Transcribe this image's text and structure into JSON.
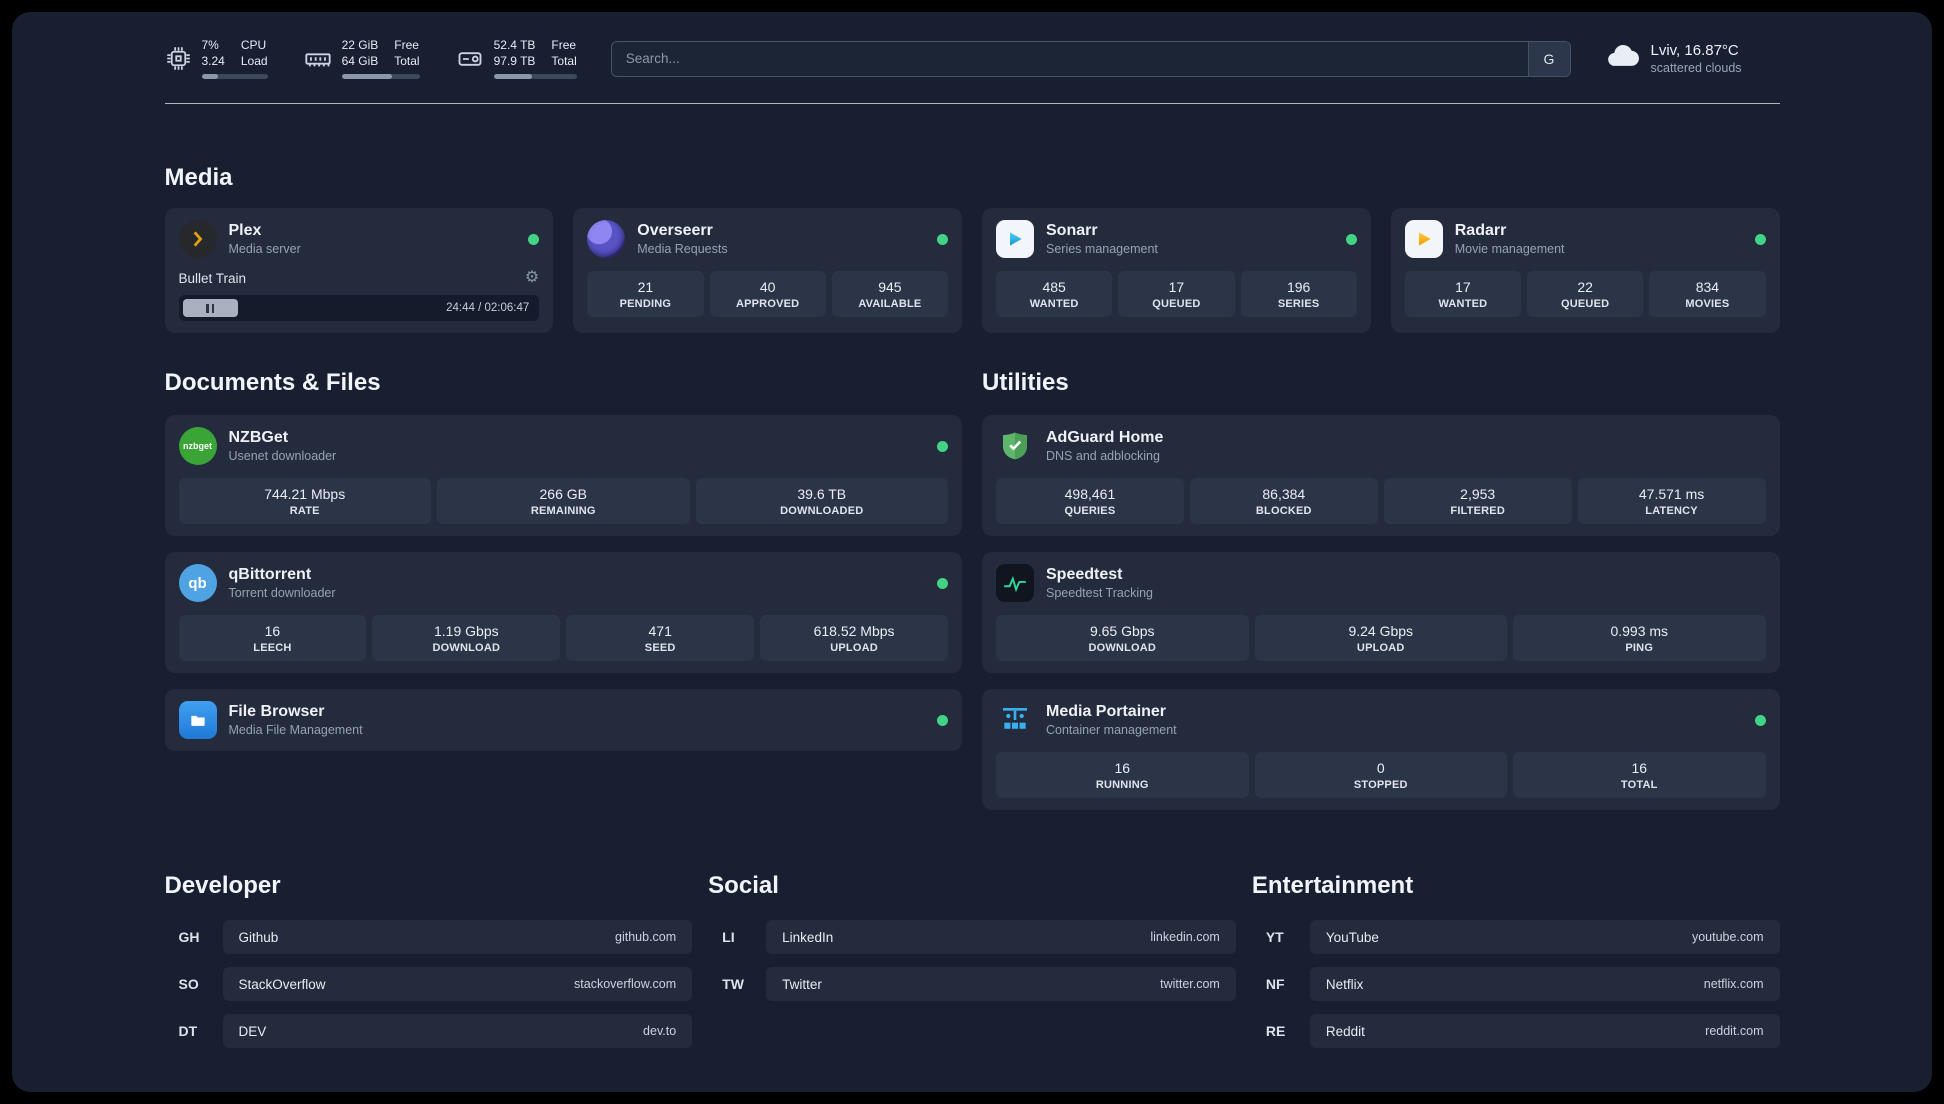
{
  "colors": {
    "page_bg": "#171f31",
    "card_bg": "#232b3d",
    "tile_bg": "#2c3547",
    "status_green": "#42d385",
    "plex_amber": "#e5a00d",
    "sonarr_blue": "#2cc5f4",
    "radarr_amber": "#ffb300",
    "nzbget_green": "#3ba437",
    "qbittorrent_blue": "#4fa3e3",
    "adguard_green": "#60b56c",
    "speedtest_green": "#2fd89a",
    "portainer_blue": "#3aaff0"
  },
  "topbar": {
    "cpu": {
      "value": "7%",
      "sub": "3.24",
      "label1": "CPU",
      "label2": "Load",
      "bar": 25
    },
    "ram": {
      "value": "22 GiB",
      "sub": "64 GiB",
      "label1": "Free",
      "label2": "Total",
      "bar": 65
    },
    "disk": {
      "value": "52.4 TB",
      "sub": "97.9 TB",
      "label1": "Free",
      "label2": "Total",
      "bar": 46
    },
    "search": {
      "placeholder": "Search...",
      "engine_label": "G"
    },
    "weather": {
      "location": "Lviv, 16.87°C",
      "condition": "scattered clouds"
    }
  },
  "sections": {
    "media": "Media",
    "documents": "Documents & Files",
    "utilities": "Utilities",
    "developer": "Developer",
    "social": "Social",
    "entertainment": "Entertainment"
  },
  "media": {
    "plex": {
      "name": "Plex",
      "desc": "Media server",
      "now_playing": "Bullet Train",
      "time": "24:44 / 02:06:47",
      "progress": 16
    },
    "overseerr": {
      "name": "Overseerr",
      "desc": "Media Requests",
      "stats": [
        {
          "value": "21",
          "label": "PENDING"
        },
        {
          "value": "40",
          "label": "APPROVED"
        },
        {
          "value": "945",
          "label": "AVAILABLE"
        }
      ]
    },
    "sonarr": {
      "name": "Sonarr",
      "desc": "Series management",
      "stats": [
        {
          "value": "485",
          "label": "WANTED"
        },
        {
          "value": "17",
          "label": "QUEUED"
        },
        {
          "value": "196",
          "label": "SERIES"
        }
      ]
    },
    "radarr": {
      "name": "Radarr",
      "desc": "Movie management",
      "stats": [
        {
          "value": "17",
          "label": "WANTED"
        },
        {
          "value": "22",
          "label": "QUEUED"
        },
        {
          "value": "834",
          "label": "MOVIES"
        }
      ]
    }
  },
  "documents": {
    "nzbget": {
      "name": "NZBGet",
      "desc": "Usenet downloader",
      "stats": [
        {
          "value": "744.21 Mbps",
          "label": "RATE"
        },
        {
          "value": "266 GB",
          "label": "REMAINING"
        },
        {
          "value": "39.6 TB",
          "label": "DOWNLOADED"
        }
      ]
    },
    "qbittorrent": {
      "name": "qBittorrent",
      "desc": "Torrent downloader",
      "stats": [
        {
          "value": "16",
          "label": "LEECH"
        },
        {
          "value": "1.19 Gbps",
          "label": "DOWNLOAD"
        },
        {
          "value": "471",
          "label": "SEED"
        },
        {
          "value": "618.52 Mbps",
          "label": "UPLOAD"
        }
      ]
    },
    "filebrowser": {
      "name": "File Browser",
      "desc": "Media File Management"
    }
  },
  "utilities": {
    "adguard": {
      "name": "AdGuard Home",
      "desc": "DNS and adblocking",
      "stats": [
        {
          "value": "498,461",
          "label": "QUERIES"
        },
        {
          "value": "86,384",
          "label": "BLOCKED"
        },
        {
          "value": "2,953",
          "label": "FILTERED"
        },
        {
          "value": "47.571 ms",
          "label": "LATENCY"
        }
      ]
    },
    "speedtest": {
      "name": "Speedtest",
      "desc": "Speedtest Tracking",
      "stats": [
        {
          "value": "9.65 Gbps",
          "label": "DOWNLOAD"
        },
        {
          "value": "9.24 Gbps",
          "label": "UPLOAD"
        },
        {
          "value": "0.993 ms",
          "label": "PING"
        }
      ]
    },
    "portainer": {
      "name": "Media Portainer",
      "desc": "Container management",
      "stats": [
        {
          "value": "16",
          "label": "RUNNING"
        },
        {
          "value": "0",
          "label": "STOPPED"
        },
        {
          "value": "16",
          "label": "TOTAL"
        }
      ]
    }
  },
  "bookmarks": {
    "developer": [
      {
        "abbr": "GH",
        "name": "Github",
        "url": "github.com"
      },
      {
        "abbr": "SO",
        "name": "StackOverflow",
        "url": "stackoverflow.com"
      },
      {
        "abbr": "DT",
        "name": "DEV",
        "url": "dev.to"
      }
    ],
    "social": [
      {
        "abbr": "LI",
        "name": "LinkedIn",
        "url": "linkedin.com"
      },
      {
        "abbr": "TW",
        "name": "Twitter",
        "url": "twitter.com"
      }
    ],
    "entertainment": [
      {
        "abbr": "YT",
        "name": "YouTube",
        "url": "youtube.com"
      },
      {
        "abbr": "NF",
        "name": "Netflix",
        "url": "netflix.com"
      },
      {
        "abbr": "RE",
        "name": "Reddit",
        "url": "reddit.com"
      }
    ]
  },
  "icons": {
    "gear": "⚙",
    "nzbget_label": "nzbget",
    "qb_label": "qb"
  }
}
